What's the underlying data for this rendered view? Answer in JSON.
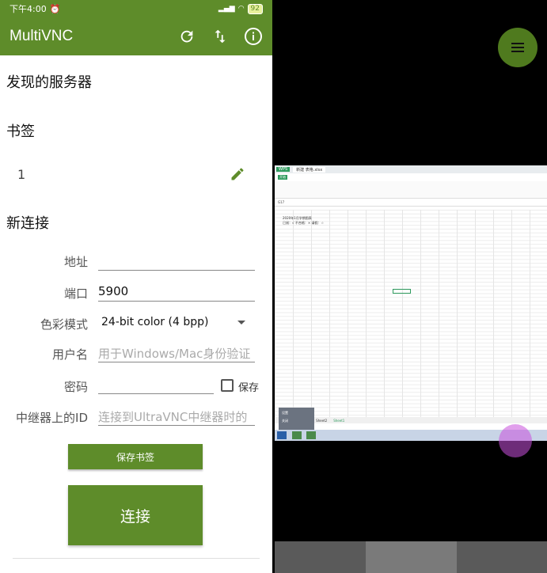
{
  "status_bar": {
    "time": "下午4:00",
    "battery": "92"
  },
  "app": {
    "title": "MultiVNC"
  },
  "sections": {
    "discovered": "发现的服务器",
    "bookmarks": "书签",
    "new_connection": "新连接"
  },
  "bookmarks": [
    {
      "name": "1"
    }
  ],
  "form": {
    "address_label": "地址",
    "address_value": "",
    "port_label": "端口",
    "port_value": "5900",
    "color_label": "色彩模式",
    "color_value": "24-bit color (4 bpp)",
    "username_label": "用户名",
    "username_placeholder": "用于Windows/Mac身份验证",
    "password_label": "密码",
    "password_value": "",
    "save_checkbox_label": "保存",
    "repeater_label": "中继器上的ID",
    "repeater_placeholder": "连接到UltraVNC中继器时的"
  },
  "buttons": {
    "save_bookmark": "保存书签",
    "connect": "连接"
  },
  "remote": {
    "tab_active": "新建 表格.xlsx",
    "ribbon_active": "开始",
    "cell_ref": "G17",
    "cell_a1": "2020年1月学期图表",
    "cell_a2": "已阅：√  不合格：×  请假：☆",
    "sheets": [
      "Sheet1",
      "Sheet2",
      "Sheet3"
    ],
    "popup_items": [
      "设置",
      "关闭"
    ]
  },
  "colors": {
    "brand_green": "#5e8c2a",
    "touch_indicator": "#c850dc"
  }
}
